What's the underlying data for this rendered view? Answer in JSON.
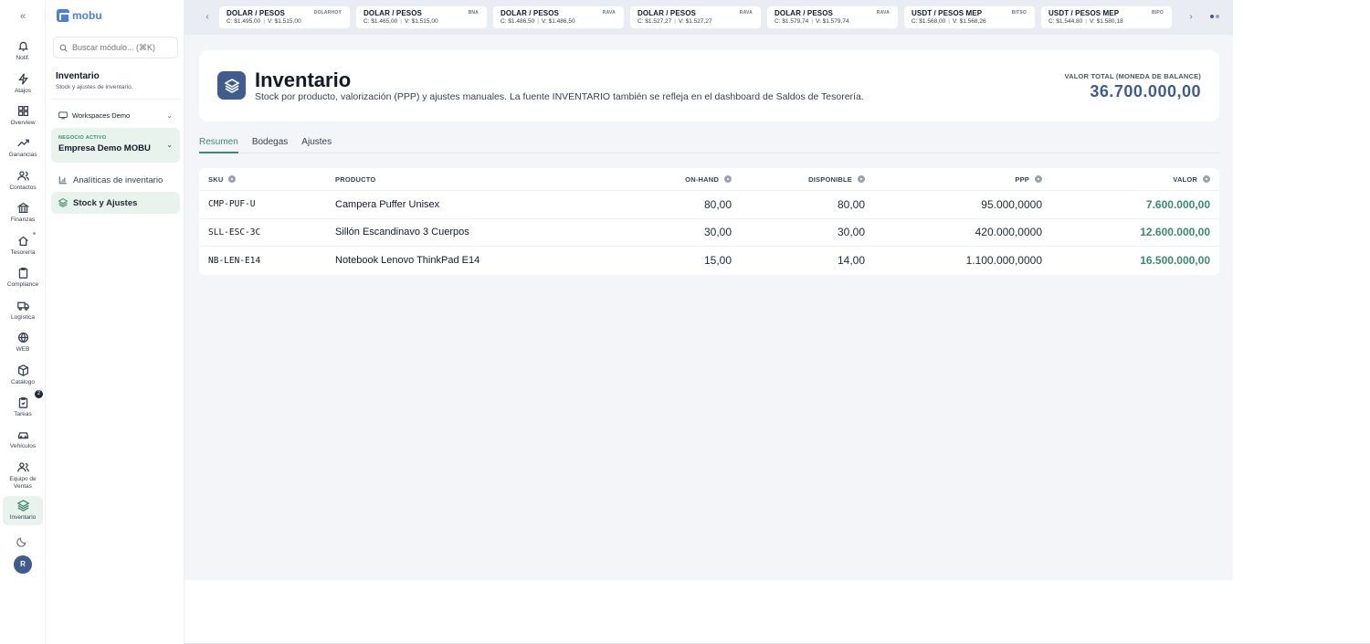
{
  "app": {
    "logo_text": "mobu",
    "avatar_initial": "R"
  },
  "rail": {
    "items": [
      {
        "label": "Notif."
      },
      {
        "label": "Atajos"
      },
      {
        "label": "Overview"
      },
      {
        "label": "Ganancias"
      },
      {
        "label": "Contactos"
      },
      {
        "label": "Finanzas"
      },
      {
        "label": "Tesorería"
      },
      {
        "label": "Compliance"
      },
      {
        "label": "Logística"
      },
      {
        "label": "WEB"
      },
      {
        "label": "Catálogo"
      },
      {
        "label": "Tareas",
        "badge": "2"
      },
      {
        "label": "Vehículos"
      },
      {
        "label": "Equipo de Ventas"
      },
      {
        "label": "Inventario"
      }
    ]
  },
  "sidebar": {
    "search_placeholder": "Buscar módulo... (⌘K)",
    "title": "Inventario",
    "subtitle": "Stock y ajustes de inventario.",
    "workspace": "Workspaces Demo",
    "business_label": "NEGOCIO ACTIVO",
    "business_name": "Empresa Demo MOBU",
    "nav": [
      {
        "label": "Analíticas de inventario"
      },
      {
        "label": "Stock y Ajustes"
      }
    ]
  },
  "ticker": [
    {
      "name": "DOLAR / PESOS",
      "badge": "DOLARHOY",
      "buy": "C: $1.495,00",
      "sell": "V: $1.515,00"
    },
    {
      "name": "DOLAR / PESOS",
      "badge": "BNA",
      "buy": "C: $1.465,00",
      "sell": "V: $1.515,00"
    },
    {
      "name": "DOLAR / PESOS",
      "badge": "RAVA",
      "buy": "C: $1.486,50",
      "sell": "V: $1.486,50"
    },
    {
      "name": "DOLAR / PESOS",
      "badge": "RAVA",
      "buy": "C: $1.527,27",
      "sell": "V: $1.527,27"
    },
    {
      "name": "DOLAR / PESOS",
      "badge": "RAVA",
      "buy": "C: $1.579,74",
      "sell": "V: $1.579,74"
    },
    {
      "name": "USDT / PESOS MEP",
      "badge": "BITSO",
      "buy": "C: $1.568,00",
      "sell": "V: $1.568,26"
    },
    {
      "name": "USDT / PESOS MEP",
      "badge": "BIPO",
      "buy": "C: $1.544,80",
      "sell": "V: $1.580,18"
    }
  ],
  "hero": {
    "title": "Inventario",
    "description": "Stock por producto, valorización (PPP) y ajustes manuales. La fuente INVENTARIO también se refleja en el dashboard de Saldos de Tesorería.",
    "value_label": "VALOR TOTAL (MONEDA DE BALANCE)",
    "value": "36.700.000,00"
  },
  "tabs": [
    {
      "label": "Resumen",
      "active": true
    },
    {
      "label": "Bodegas"
    },
    {
      "label": "Ajustes"
    }
  ],
  "table": {
    "columns": {
      "sku": "SKU",
      "product": "PRODUCTO",
      "on_hand": "ON-HAND",
      "available": "DISPONIBLE",
      "ppp": "PPP",
      "value": "VALOR"
    },
    "rows": [
      {
        "sku": "CMP-PUF-U",
        "product": "Campera Puffer Unisex",
        "on_hand": "80,00",
        "available": "80,00",
        "ppp": "95.000,0000",
        "value": "7.600.000,00"
      },
      {
        "sku": "SLL-ESC-3C",
        "product": "Sillón Escandinavo 3 Cuerpos",
        "on_hand": "30,00",
        "available": "30,00",
        "ppp": "420.000,0000",
        "value": "12.600.000,00"
      },
      {
        "sku": "NB-LEN-E14",
        "product": "Notebook Lenovo ThinkPad E14",
        "on_hand": "15,00",
        "available": "14,00",
        "ppp": "1.100.000,0000",
        "value": "16.500.000,00"
      }
    ]
  },
  "colors": {
    "accent_green": "#3b8a6c",
    "brand_blue": "#3e5c8e",
    "logo_blue": "#4a7fd6"
  }
}
